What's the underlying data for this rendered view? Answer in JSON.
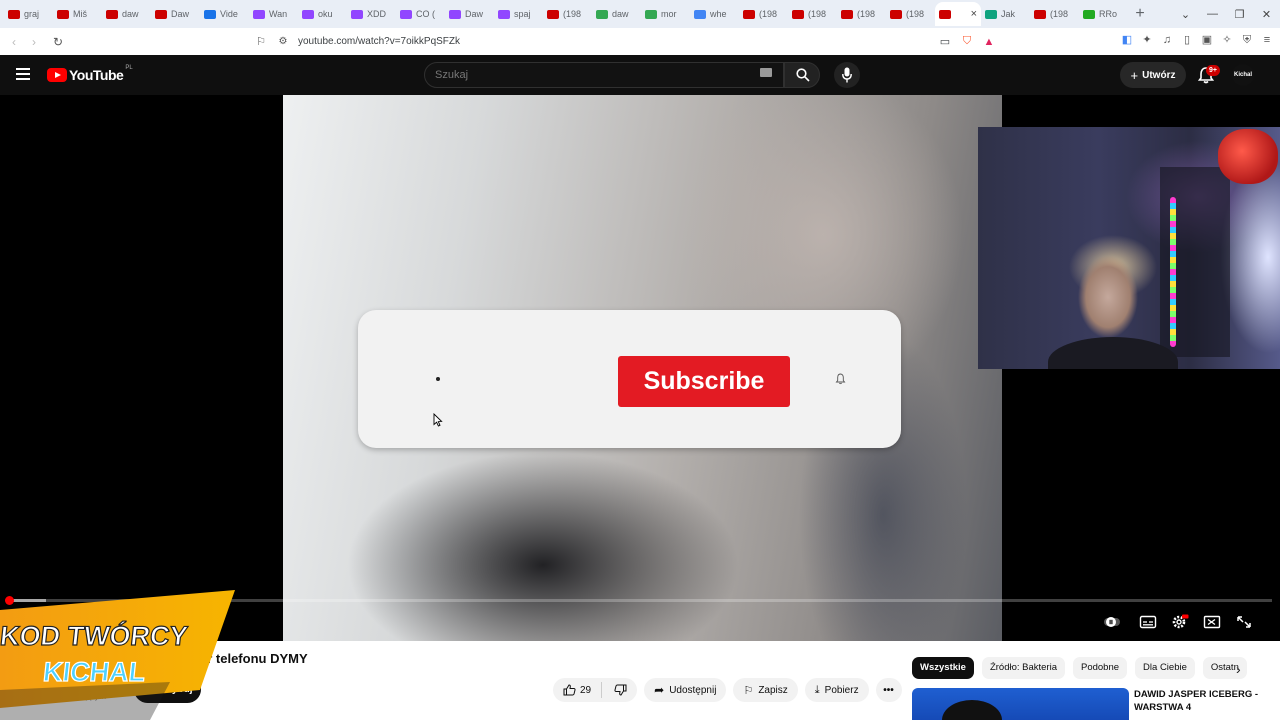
{
  "browser": {
    "tabs": [
      {
        "label": "graj",
        "color": "#cc0000"
      },
      {
        "label": "Miš",
        "color": "#cc0000"
      },
      {
        "label": "daw",
        "color": "#cc0000"
      },
      {
        "label": "Daw",
        "color": "#cc0000"
      },
      {
        "label": "Vide",
        "color": "#1a73e8"
      },
      {
        "label": "Wan",
        "color": "#9146ff"
      },
      {
        "label": "oku",
        "color": "#9146ff"
      },
      {
        "label": "XDD",
        "color": "#9146ff"
      },
      {
        "label": "CO (",
        "color": "#9146ff"
      },
      {
        "label": "Daw",
        "color": "#9146ff"
      },
      {
        "label": "spaj",
        "color": "#9146ff"
      },
      {
        "label": "(198",
        "color": "#cc0000"
      },
      {
        "label": "daw",
        "color": "#34a853"
      },
      {
        "label": "mor",
        "color": "#34a853"
      },
      {
        "label": "whe",
        "color": "#4285f4"
      },
      {
        "label": "(198",
        "color": "#cc0000"
      },
      {
        "label": "(198",
        "color": "#cc0000"
      },
      {
        "label": "(198",
        "color": "#cc0000"
      },
      {
        "label": "(198",
        "color": "#cc0000"
      },
      {
        "label": "",
        "color": "#cc0000",
        "active": true
      },
      {
        "label": "Jak",
        "color": "#10a37f"
      },
      {
        "label": "(198",
        "color": "#cc0000"
      },
      {
        "label": "RRo",
        "color": "#22aa22"
      }
    ],
    "new_tab": "+",
    "active_tab_close": "×",
    "url": "youtube.com/watch?v=7oikkPqSFZk"
  },
  "youtube": {
    "logo_text": "YouTube",
    "region": "PL",
    "search_placeholder": "Szukaj",
    "create_label": "Utwórz",
    "notifications_badge": "9+",
    "avatar_text": "Kichal"
  },
  "video": {
    "overlay_subscribe": "Subscribe",
    "progress_played": 0.002,
    "progress_buffered": 0.03
  },
  "promo": {
    "line1": "KOD TWÓRCY",
    "line2": "KICHAL"
  },
  "below": {
    "title_fragment": "er telefonu DYMY",
    "subscribe_fragment": "ybuj",
    "channel_subs_fragment": "jących",
    "like_count": "29",
    "share_label": "Udostępnij",
    "save_label": "Zapisz",
    "download_label": "Pobierz"
  },
  "chips": [
    "Wszystkie",
    "Źródło: Bakteria",
    "Podobne",
    "Dla Ciebie",
    "Ostatn"
  ],
  "recommended": {
    "title": "DAWID JASPER ICEBERG - WARSTWA 4"
  }
}
